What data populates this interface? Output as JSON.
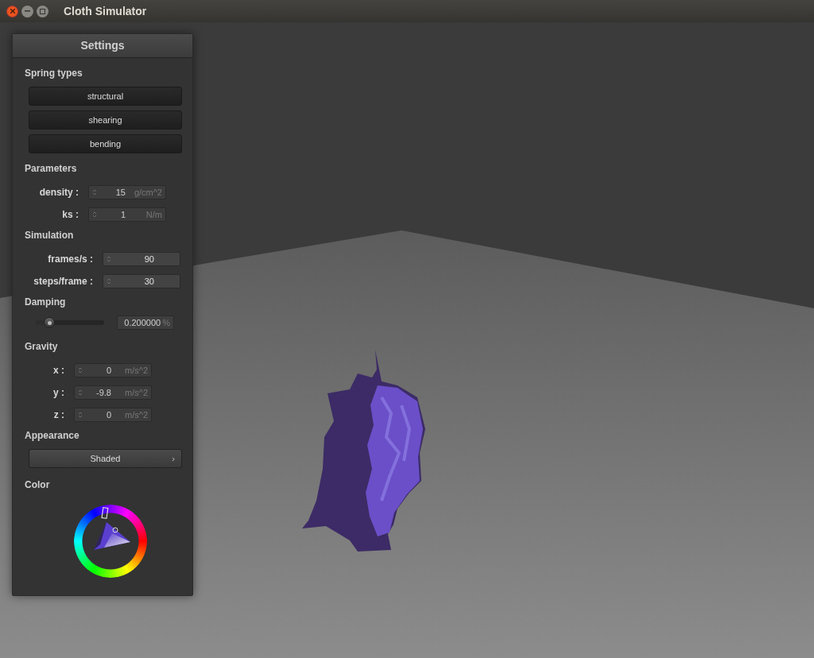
{
  "window": {
    "title": "Cloth Simulator"
  },
  "panel": {
    "title": "Settings",
    "sections": [
      {
        "kind": "buttons",
        "title": "Spring types",
        "buttons": [
          "structural",
          "shearing",
          "bending"
        ]
      },
      {
        "kind": "fields",
        "title": "Parameters",
        "fields": [
          {
            "label": "density :",
            "value": "15",
            "unit": "g/cm^2",
            "disabled": true
          },
          {
            "label": "ks :",
            "value": "1",
            "unit": "N/m",
            "disabled": true
          }
        ]
      },
      {
        "kind": "fields",
        "title": "Simulation",
        "fields": [
          {
            "label": "frames/s :",
            "value": "90",
            "disabled": false
          },
          {
            "label": "steps/frame :",
            "value": "30",
            "disabled": false
          }
        ]
      },
      {
        "kind": "slider",
        "title": "Damping",
        "level": 0.2,
        "value": "0.200000",
        "unit": "%"
      },
      {
        "kind": "fields",
        "title": "Gravity",
        "fields": [
          {
            "label": "x :",
            "value": "0",
            "unit": "m/s^2",
            "disabled": true
          },
          {
            "label": "y :",
            "value": "-9.8",
            "unit": "m/s^2",
            "disabled": true
          },
          {
            "label": "z :",
            "value": "0",
            "unit": "m/s^2",
            "disabled": true
          }
        ]
      },
      {
        "kind": "dropdown",
        "title": "Appearance",
        "value": "Shaded",
        "caret": "›"
      },
      {
        "kind": "color",
        "title": "Color",
        "color": "#5a3fd0"
      }
    ]
  }
}
